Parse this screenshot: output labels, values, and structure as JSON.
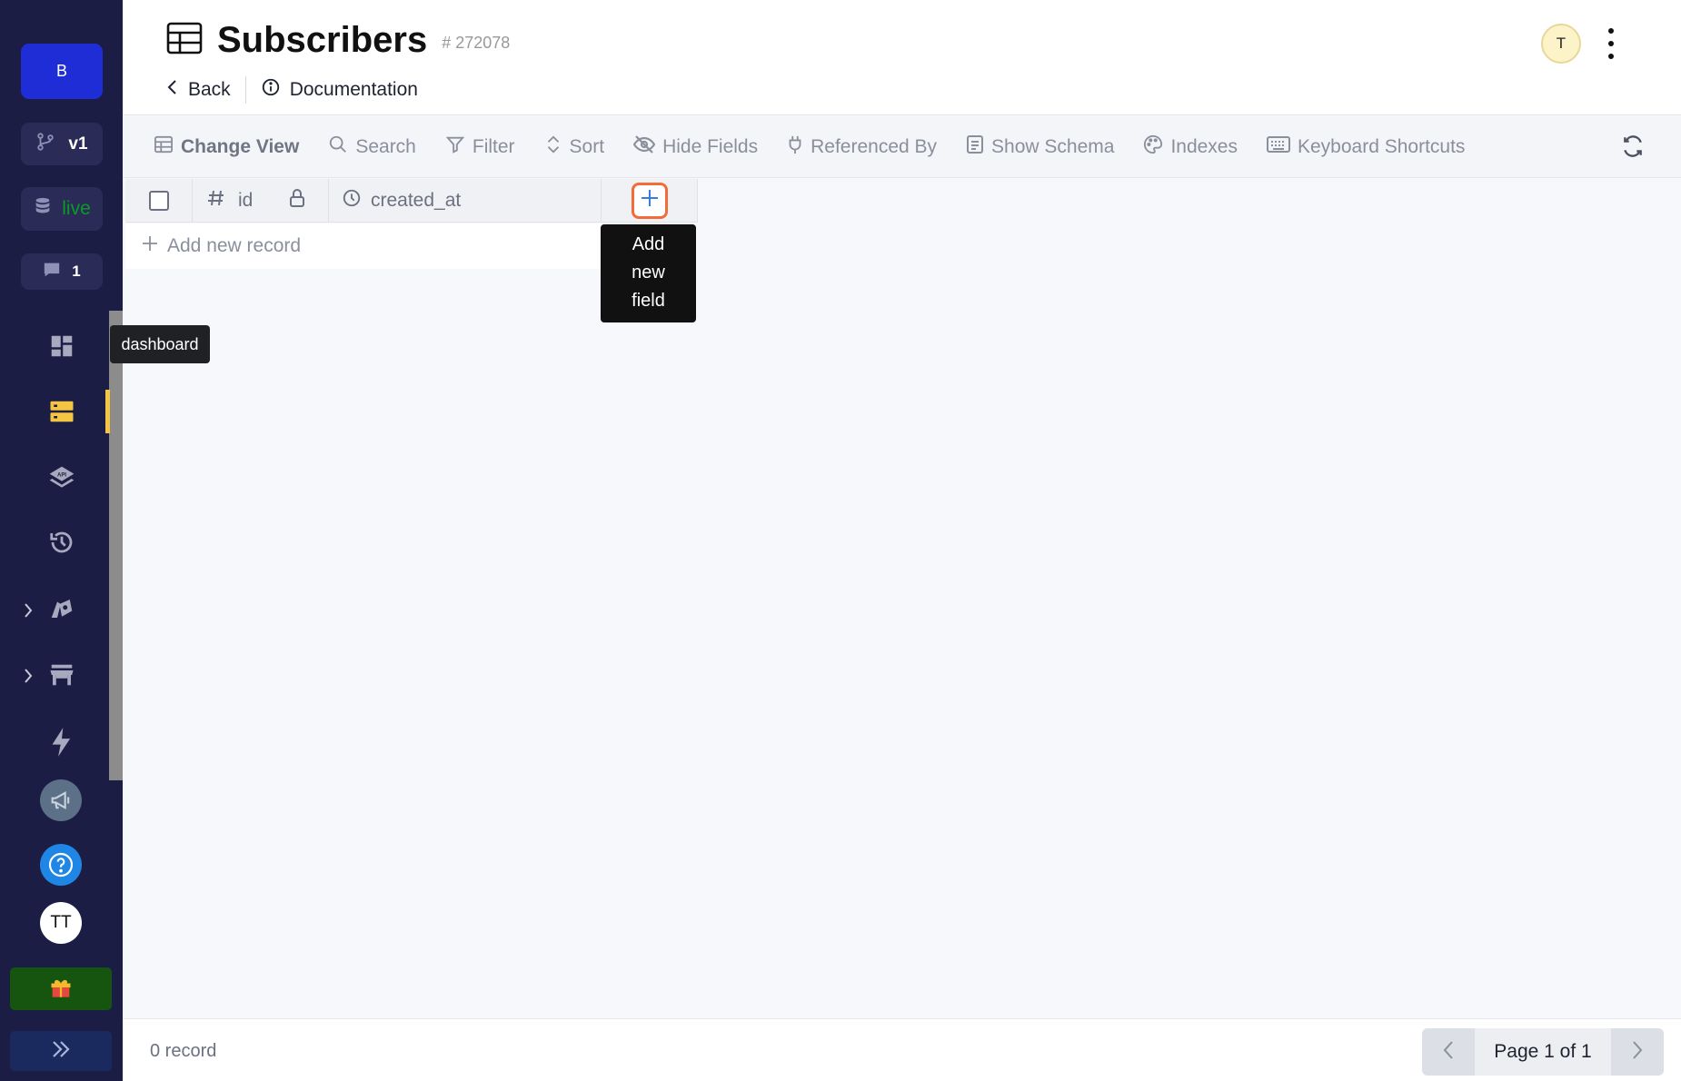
{
  "sidebar": {
    "branch_label": "B",
    "version_label": "v1",
    "live_label": "live",
    "comments_count": "1",
    "tooltip": "dashboard",
    "user_initials": "TT",
    "icons": [
      "git-branch-icon",
      "database-icon",
      "comment-icon",
      "dashboard-icon",
      "database-table-icon",
      "api-layers-icon",
      "history-icon",
      "addons-icon",
      "marketplace-icon",
      "lightning-icon",
      "megaphone-icon",
      "help-icon",
      "gift-icon",
      "double-chevron-right-icon"
    ],
    "colors": {
      "background": "#1c1d44",
      "branch": "#1f2dd6",
      "live_text": "#0a9b25",
      "active_indicator": "#f4c542",
      "gift_bg": "#15550f"
    }
  },
  "header": {
    "title": "Subscribers",
    "table_id": "# 272078",
    "back_label": "Back",
    "docs_label": "Documentation",
    "avatar_initial": "T"
  },
  "toolbar": {
    "change_view": "Change View",
    "search": "Search",
    "filter": "Filter",
    "sort": "Sort",
    "hide_fields": "Hide Fields",
    "referenced_by": "Referenced By",
    "show_schema": "Show Schema",
    "indexes": "Indexes",
    "keyboard_shortcuts": "Keyboard Shortcuts"
  },
  "grid": {
    "columns": [
      {
        "name": "id",
        "icon": "hash-icon",
        "locked": true
      },
      {
        "name": "created_at",
        "icon": "clock-icon"
      }
    ],
    "add_record_label": "Add new record",
    "add_field_tooltip": [
      "Add",
      "new",
      "field"
    ],
    "accent": "#f26c3a"
  },
  "footer": {
    "record_count": "0 record",
    "page_label": "Page 1 of 1"
  }
}
